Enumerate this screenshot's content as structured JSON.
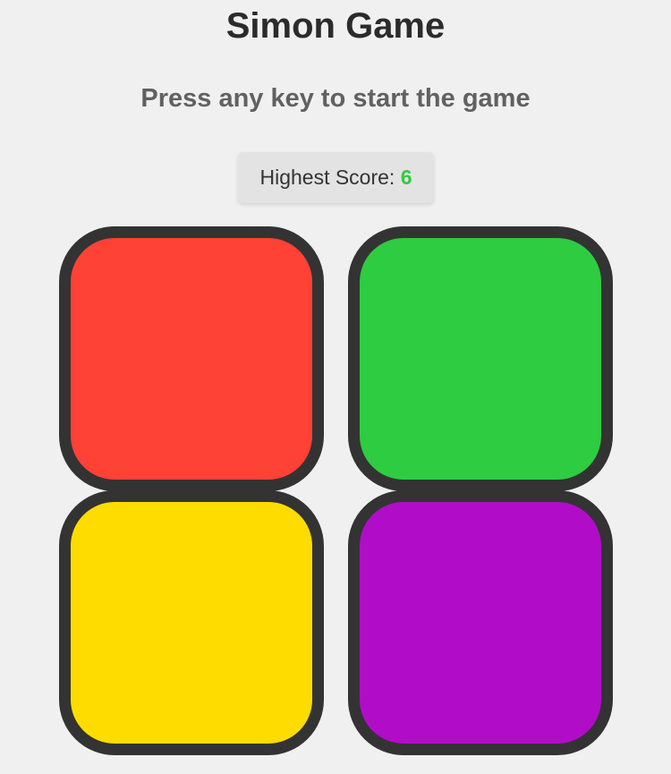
{
  "game": {
    "title": "Simon Game",
    "status_message": "Press any key to start the game",
    "score_label": "Highest Score: ",
    "highest_score": "6"
  },
  "buttons": [
    {
      "id": "red",
      "color": "#ff4136"
    },
    {
      "id": "green",
      "color": "#2ecc40"
    },
    {
      "id": "yellow",
      "color": "#ffdc00"
    },
    {
      "id": "purple",
      "color": "#b10dc9"
    }
  ],
  "colors": {
    "background": "#f0f0f0",
    "button_border": "#333333",
    "score_highlight": "#2ecc40"
  }
}
